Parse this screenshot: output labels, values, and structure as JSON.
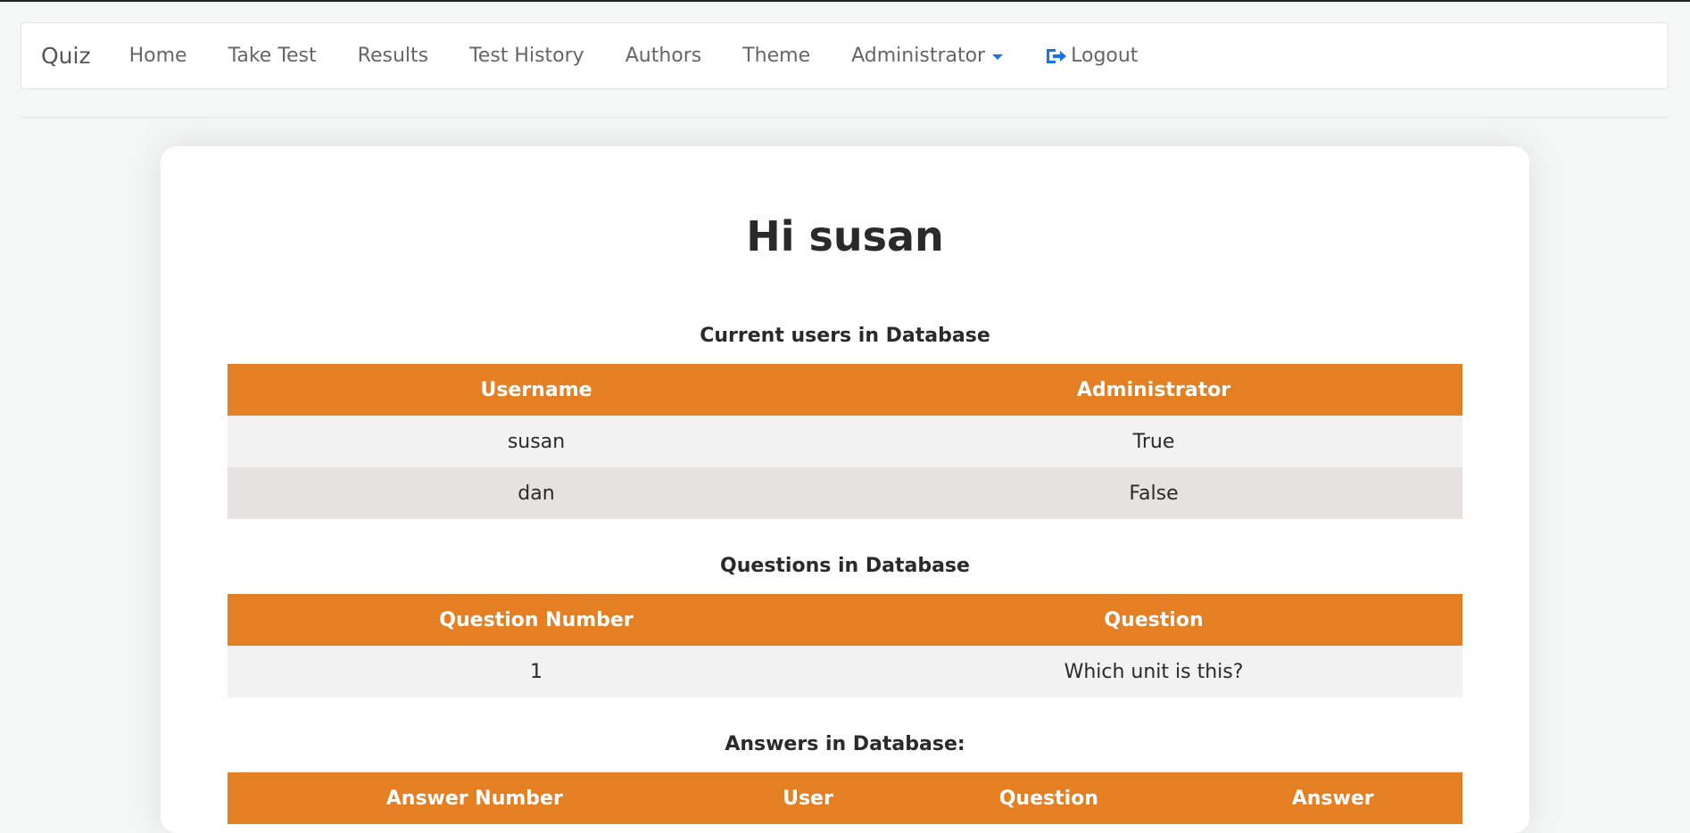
{
  "nav": {
    "brand": "Quiz",
    "items": [
      "Home",
      "Take Test",
      "Results",
      "Test History",
      "Authors",
      "Theme"
    ],
    "admin_label": "Administrator",
    "logout_label": "Logout"
  },
  "greeting": "Hi susan",
  "users_section": {
    "title": "Current users in Database",
    "headers": [
      "Username",
      "Administrator"
    ],
    "rows": [
      [
        "susan",
        "True"
      ],
      [
        "dan",
        "False"
      ]
    ]
  },
  "questions_section": {
    "title": "Questions in Database",
    "headers": [
      "Question Number",
      "Question"
    ],
    "rows": [
      [
        "1",
        "Which unit is this?"
      ]
    ]
  },
  "answers_section": {
    "title": "Answers in Database:",
    "headers": [
      "Answer Number",
      "User",
      "Question",
      "Answer"
    ]
  },
  "colors": {
    "accent": "#e47f23",
    "row_odd": "#f2f2f2",
    "row_even": "#e6e2df",
    "logout_icon": "#1a73e8"
  }
}
